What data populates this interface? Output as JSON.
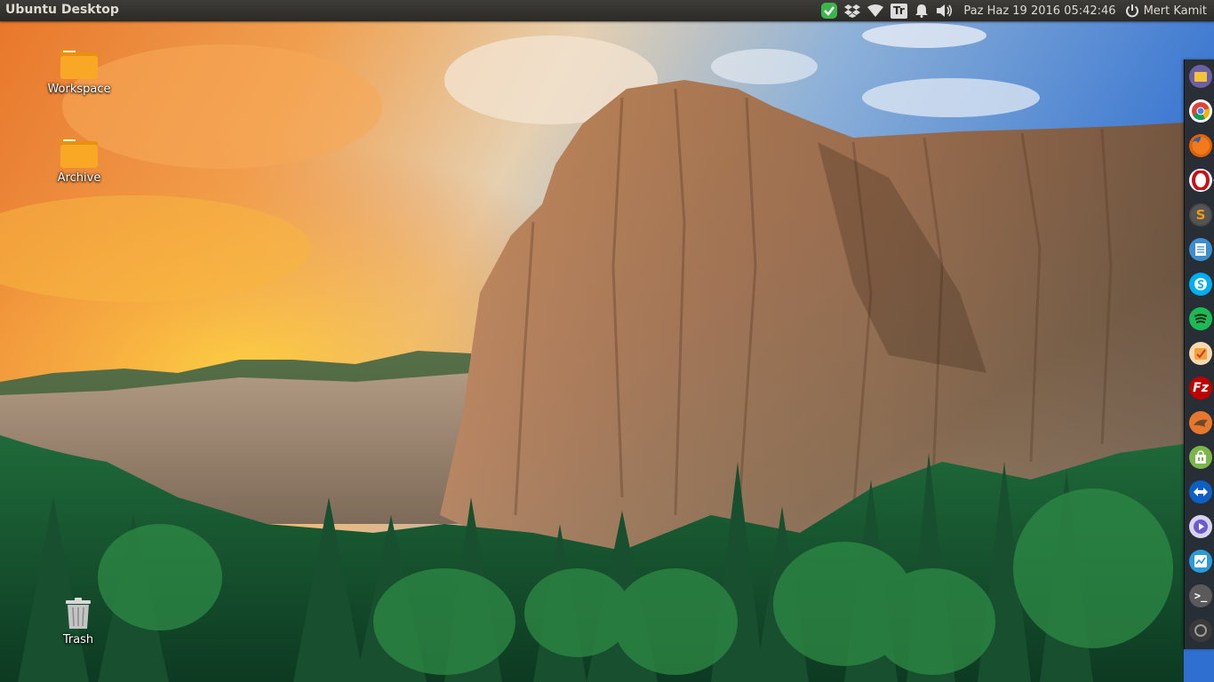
{
  "panel": {
    "title": "Ubuntu Desktop",
    "clock": "Paz Haz 19 2016 05:42:46",
    "user": "Mert Kamit",
    "tray": [
      "checkmark-icon",
      "dropbox-icon",
      "wifi-icon",
      "keyboard-layout-icon",
      "notification-bell-icon",
      "volume-icon"
    ],
    "keyboard_label": "Tr"
  },
  "desktop": {
    "icons": [
      {
        "name": "workspace",
        "label": "Workspace",
        "type": "folder"
      },
      {
        "name": "archive",
        "label": "Archive",
        "type": "folder"
      },
      {
        "name": "trash",
        "label": "Trash",
        "type": "trash"
      }
    ]
  },
  "launcher": {
    "items": [
      {
        "name": "files",
        "icon": "files-icon",
        "color": "#7a6ca6"
      },
      {
        "name": "chrome",
        "icon": "chrome-icon",
        "color": "#db4437"
      },
      {
        "name": "firefox",
        "icon": "firefox-icon",
        "color": "#e66000"
      },
      {
        "name": "opera",
        "icon": "opera-icon",
        "color": "#cc0f16"
      },
      {
        "name": "sublime",
        "icon": "sublime-text-icon",
        "color": "#d58b2a"
      },
      {
        "name": "text-editor",
        "icon": "text-editor-icon",
        "color": "#3b8ed0"
      },
      {
        "name": "skype",
        "icon": "skype-icon",
        "color": "#00aff0"
      },
      {
        "name": "spotify",
        "icon": "spotify-icon",
        "color": "#1db954"
      },
      {
        "name": "todo",
        "icon": "todo-icon",
        "color": "#f2a33c"
      },
      {
        "name": "filezilla",
        "icon": "filezilla-icon",
        "color": "#bf0000"
      },
      {
        "name": "mysql-workbench",
        "icon": "database-tool-icon",
        "color": "#e8772e"
      },
      {
        "name": "software-center",
        "icon": "software-center-icon",
        "color": "#7ab648"
      },
      {
        "name": "teamviewer",
        "icon": "teamviewer-icon",
        "color": "#0e5fc4"
      },
      {
        "name": "media-player",
        "icon": "media-player-icon",
        "color": "#6b5bd1"
      },
      {
        "name": "system-monitor",
        "icon": "system-monitor-icon",
        "color": "#2a9ad8"
      },
      {
        "name": "terminal",
        "icon": "terminal-icon",
        "color": "#3a3a3a"
      },
      {
        "name": "trash",
        "icon": "launcher-trash-icon",
        "color": "#6b6b6b"
      }
    ]
  }
}
